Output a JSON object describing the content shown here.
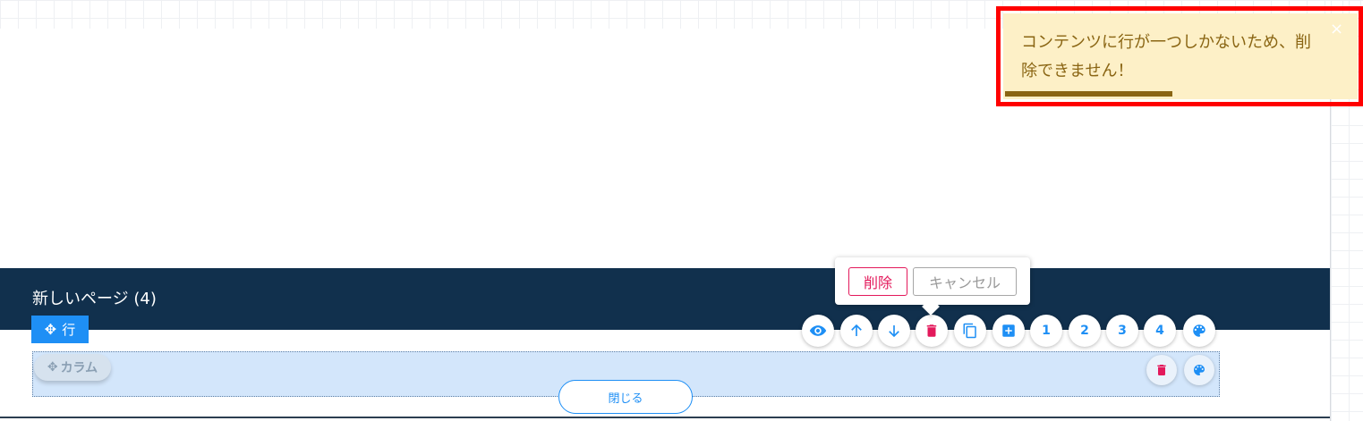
{
  "page": {
    "title": "新しいページ (4)"
  },
  "row": {
    "handle_label": "行",
    "toolbar": [
      {
        "name": "preview",
        "icon": "eye-icon"
      },
      {
        "name": "move-up",
        "icon": "arrow-up-icon"
      },
      {
        "name": "move-down",
        "icon": "arrow-down-icon"
      },
      {
        "name": "delete",
        "icon": "trash-icon"
      },
      {
        "name": "duplicate",
        "icon": "copy-icon"
      },
      {
        "name": "add",
        "icon": "plus-box-icon"
      },
      {
        "name": "columns-1",
        "label": "1"
      },
      {
        "name": "columns-2",
        "label": "2"
      },
      {
        "name": "columns-3",
        "label": "3"
      },
      {
        "name": "columns-4",
        "label": "4"
      },
      {
        "name": "style",
        "icon": "palette-icon"
      }
    ]
  },
  "column": {
    "handle_label": "カラム",
    "toolbar": [
      {
        "name": "delete",
        "icon": "trash-icon"
      },
      {
        "name": "style",
        "icon": "palette-icon"
      }
    ]
  },
  "close_label": "閉じる",
  "popover": {
    "delete_label": "削除",
    "cancel_label": "キャンセル"
  },
  "toast": {
    "message": "コンテンツに行が一つしかないため、削除できません！",
    "close_glyph": "×",
    "progress": 0.48
  },
  "colors": {
    "header_bg": "#11304d",
    "accent": "#1e8ff5",
    "danger": "#e3195b",
    "toast_bg": "#fdf0c7",
    "toast_text": "#8a6513",
    "highlight": "#ff0000"
  }
}
